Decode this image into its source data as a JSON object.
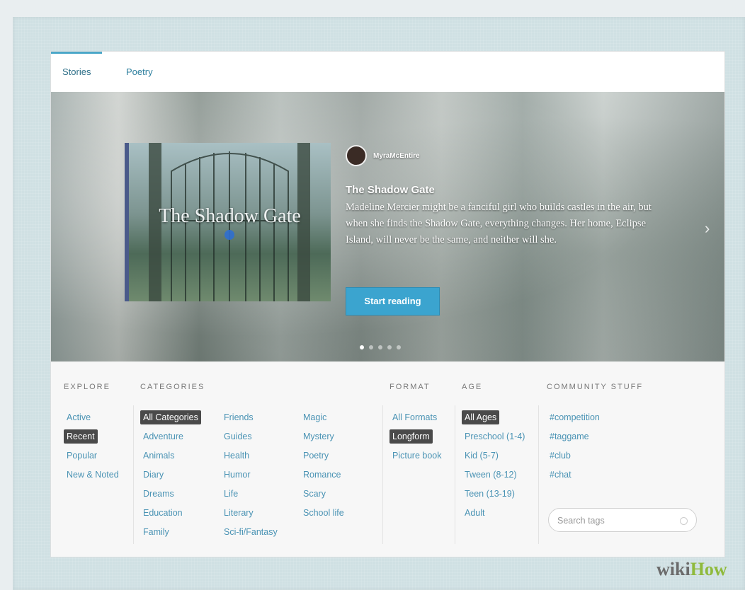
{
  "tabs": [
    {
      "label": "Stories",
      "active": true
    },
    {
      "label": "Poetry",
      "active": false
    }
  ],
  "featured": {
    "cover_title": "The Shadow Gate",
    "author": "MyraMcEntire",
    "title": "The Shadow Gate",
    "description": "Madeline Mercier might be a fanciful girl who builds castles in the air, but when she finds the Shadow Gate, everything changes. Her home, Eclipse Island, will never be the same, and neither will she.",
    "button_label": "Start reading",
    "next_arrow": "›",
    "slide_count": 5,
    "active_slide": 1
  },
  "filters": {
    "explore": {
      "heading": "EXPLORE",
      "items": [
        {
          "label": "Active",
          "selected": false
        },
        {
          "label": "Recent",
          "selected": true
        },
        {
          "label": "Popular",
          "selected": false
        },
        {
          "label": "New & Noted",
          "selected": false
        }
      ]
    },
    "categories": {
      "heading": "CATEGORIES",
      "col1": [
        {
          "label": "All Categories",
          "selected": true
        },
        {
          "label": "Adventure",
          "selected": false
        },
        {
          "label": "Animals",
          "selected": false
        },
        {
          "label": "Diary",
          "selected": false
        },
        {
          "label": "Dreams",
          "selected": false
        },
        {
          "label": "Education",
          "selected": false
        },
        {
          "label": "Family",
          "selected": false
        }
      ],
      "col2": [
        {
          "label": "Friends",
          "selected": false
        },
        {
          "label": "Guides",
          "selected": false
        },
        {
          "label": "Health",
          "selected": false
        },
        {
          "label": "Humor",
          "selected": false
        },
        {
          "label": "Life",
          "selected": false
        },
        {
          "label": "Literary",
          "selected": false
        },
        {
          "label": "Sci-fi/Fantasy",
          "selected": false
        }
      ],
      "col3": [
        {
          "label": "Magic",
          "selected": false
        },
        {
          "label": "Mystery",
          "selected": false
        },
        {
          "label": "Poetry",
          "selected": false
        },
        {
          "label": "Romance",
          "selected": false
        },
        {
          "label": "Scary",
          "selected": false
        },
        {
          "label": "School life",
          "selected": false
        }
      ]
    },
    "format": {
      "heading": "FORMAT",
      "items": [
        {
          "label": "All Formats",
          "selected": false
        },
        {
          "label": "Longform",
          "selected": true
        },
        {
          "label": "Picture book",
          "selected": false
        }
      ]
    },
    "age": {
      "heading": "AGE",
      "items": [
        {
          "label": "All Ages",
          "selected": true
        },
        {
          "label": "Preschool (1-4)",
          "selected": false
        },
        {
          "label": "Kid (5-7)",
          "selected": false
        },
        {
          "label": "Tween (8-12)",
          "selected": false
        },
        {
          "label": "Teen (13-19)",
          "selected": false
        },
        {
          "label": "Adult",
          "selected": false
        }
      ]
    },
    "community": {
      "heading": "COMMUNITY STUFF",
      "items": [
        {
          "label": "#competition",
          "selected": false
        },
        {
          "label": "#taggame",
          "selected": false
        },
        {
          "label": "#club",
          "selected": false
        },
        {
          "label": "#chat",
          "selected": false
        }
      ],
      "search_placeholder": "Search tags"
    }
  },
  "watermark": {
    "wiki": "wiki",
    "how": "How"
  },
  "colors": {
    "accent": "#3ba4cf",
    "link": "#4a93b4",
    "selected_bg": "#4a4a4a"
  }
}
